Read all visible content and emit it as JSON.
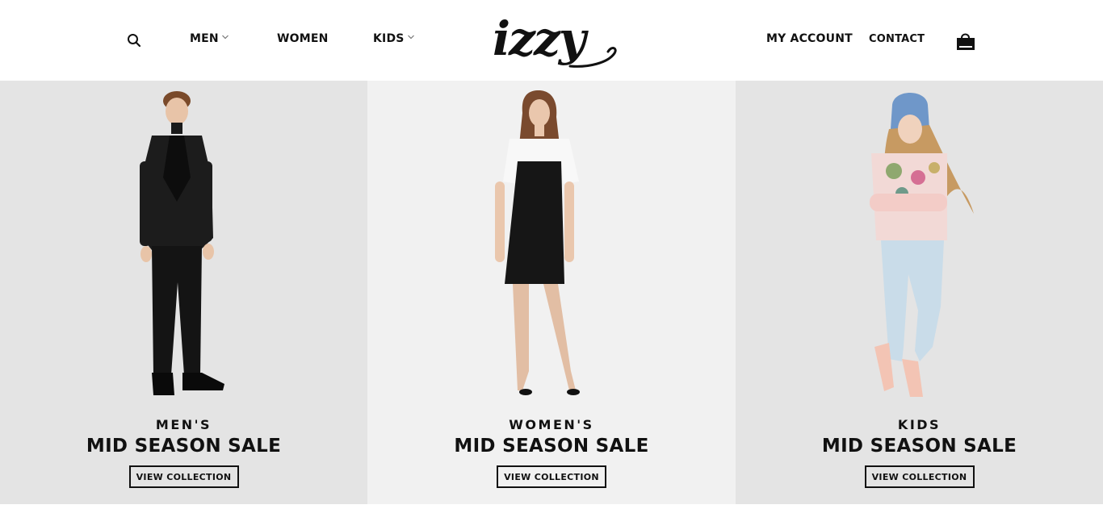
{
  "header": {
    "nav_left": [
      {
        "label": "MEN",
        "has_dropdown": true
      },
      {
        "label": "WOMEN",
        "has_dropdown": false
      },
      {
        "label": "KIDS",
        "has_dropdown": true
      }
    ],
    "logo_text": "izzy",
    "nav_right": {
      "account_label": "MY ACCOUNT",
      "contact_label": "CONTACT"
    },
    "icons": {
      "search": "search-icon",
      "cart": "shopping-bag-icon",
      "dropdown": "chevron-down-icon"
    }
  },
  "panels": [
    {
      "kicker": "MEN'S",
      "title": "MID SEASON SALE",
      "cta": "VIEW COLLECTION",
      "background": "#e4e4e4"
    },
    {
      "kicker": "WOMEN'S",
      "title": "MID SEASON SALE",
      "cta": "VIEW COLLECTION",
      "background": "#f1f1f1"
    },
    {
      "kicker": "KIDS",
      "title": "MID SEASON SALE",
      "cta": "VIEW COLLECTION",
      "background": "#e4e4e4"
    }
  ]
}
